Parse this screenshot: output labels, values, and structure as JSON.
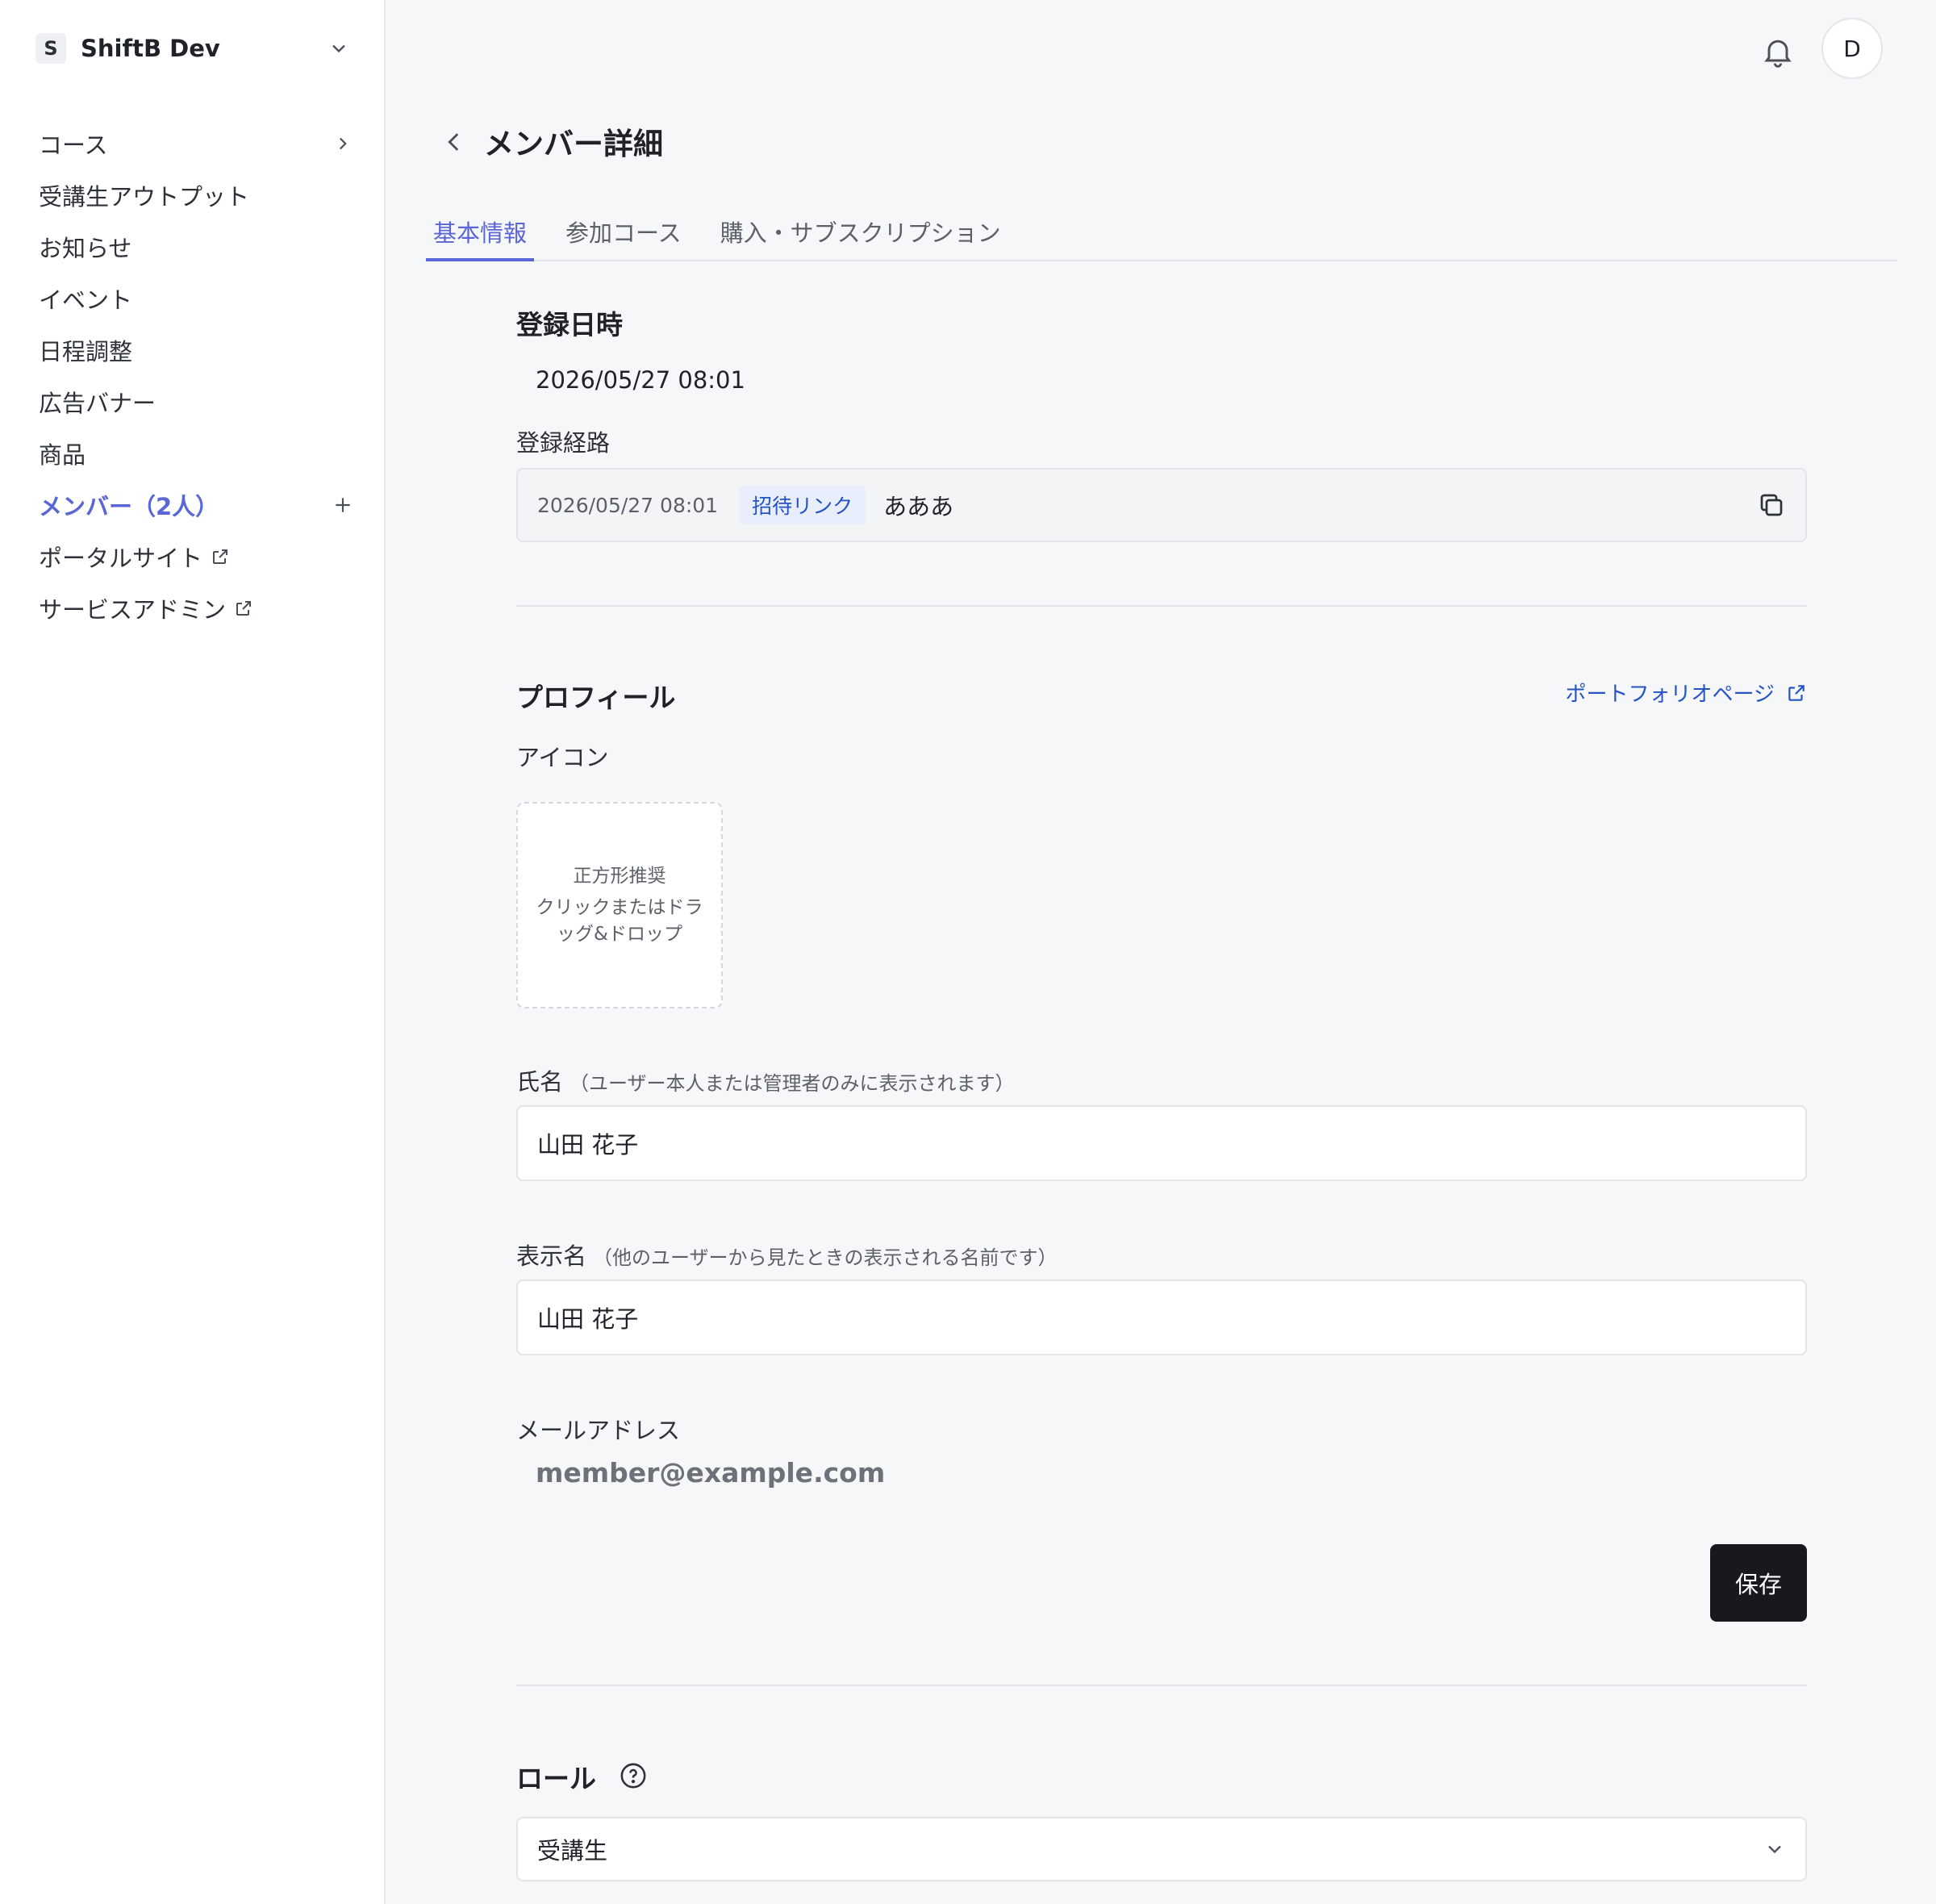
{
  "workspace": {
    "initial": "S",
    "name": "ShiftB Dev"
  },
  "sidebar": {
    "items": [
      {
        "label": "コース"
      },
      {
        "label": "受講生アウトプット"
      },
      {
        "label": "お知らせ"
      },
      {
        "label": "イベント"
      },
      {
        "label": "日程調整"
      },
      {
        "label": "広告バナー"
      },
      {
        "label": "商品"
      },
      {
        "label": "メンバー（2人）"
      },
      {
        "label": "ポータルサイト"
      },
      {
        "label": "サービスアドミン"
      }
    ]
  },
  "header": {
    "user_initial": "D"
  },
  "page": {
    "title": "メンバー詳細"
  },
  "tabs": [
    {
      "label": "基本情報",
      "active": true
    },
    {
      "label": "参加コース",
      "active": false
    },
    {
      "label": "購入・サブスクリプション",
      "active": false
    }
  ],
  "registration": {
    "heading": "登録日時",
    "datetime": "2026/05/27 08:01",
    "route_label": "登録経路",
    "route_date": "2026/05/27 08:01",
    "route_badge": "招待リンク",
    "route_name": "あああ"
  },
  "profile": {
    "heading": "プロフィール",
    "portfolio_link": "ポートフォリオページ",
    "icon_label": "アイコン",
    "dropzone_hint": "正方形推奨",
    "dropzone_text": "クリックまたはドラッグ&ドロップ",
    "full_name_label": "氏名",
    "full_name_note": "（ユーザー本人または管理者のみに表示されます）",
    "full_name_value": "山田 花子",
    "display_name_label": "表示名",
    "display_name_note": "（他のユーザーから見たときの表示される名前です）",
    "display_name_value": "山田 花子",
    "email_label": "メールアドレス",
    "email_value": "member@example.com",
    "save_label": "保存"
  },
  "role": {
    "heading": "ロール",
    "selected": "受講生"
  }
}
